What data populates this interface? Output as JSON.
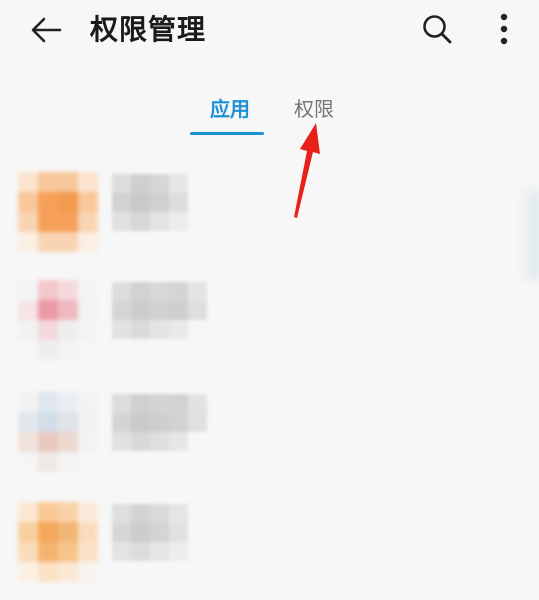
{
  "header": {
    "title": "权限管理",
    "back_icon": "arrow-left-icon",
    "search_icon": "search-icon",
    "more_icon": "more-vertical-icon"
  },
  "tabs": [
    {
      "label": "应用",
      "selected": true
    },
    {
      "label": "权限",
      "selected": false
    }
  ],
  "colors": {
    "accent": "#1e90d6",
    "annotation_arrow": "#e8201a",
    "title_text": "#1a1a1a",
    "inactive_tab": "#777777"
  },
  "list": {
    "items": [
      {
        "icon_palette": [
          "#f8c79a",
          "#f6a05a",
          "#f29a4e",
          "#f9d4b3"
        ],
        "name_redacted": true
      },
      {
        "icon_palette": [
          "#f3c7cc",
          "#ec9aa5",
          "#f5dadd",
          "#f0f0f0"
        ],
        "name_redacted": true
      },
      {
        "icon_palette": [
          "#d3dde8",
          "#e8c9c0",
          "#edd8cf",
          "#f3f3f3"
        ],
        "name_redacted": true
      },
      {
        "icon_palette": [
          "#f8c995",
          "#f5a85c",
          "#f1b777",
          "#fbe2c6"
        ],
        "name_redacted": true
      }
    ]
  }
}
